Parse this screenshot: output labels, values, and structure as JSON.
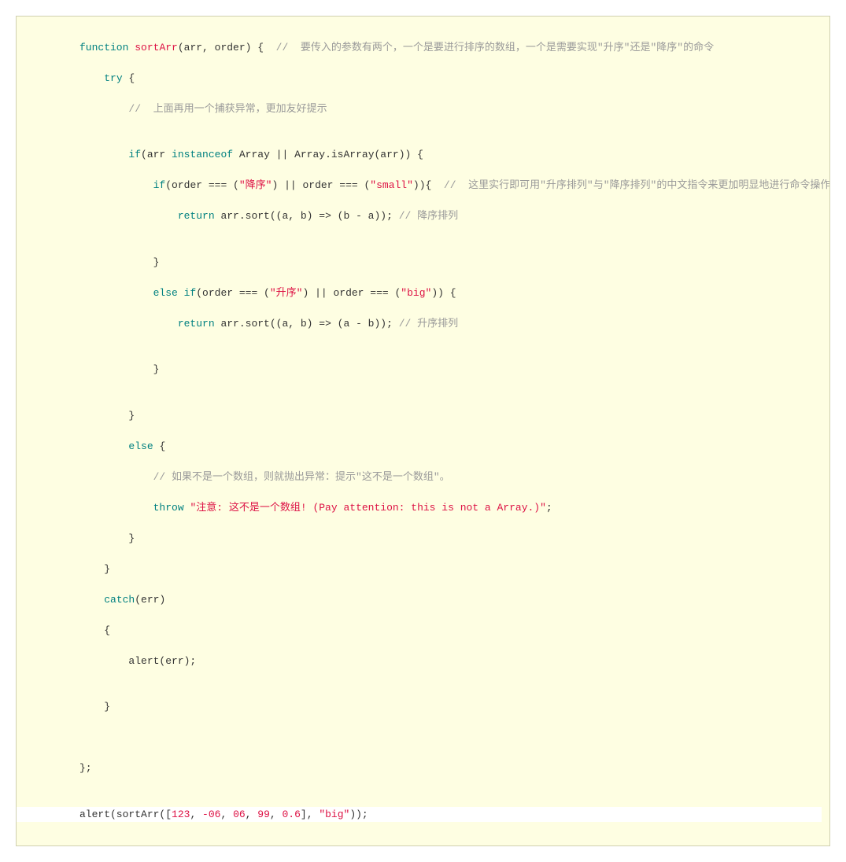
{
  "code": {
    "l1": {
      "kw1": "function",
      "fn": "sortArr",
      "p": "(arr, order) {",
      "cmt": "  //  要传入的参数有两个，一个是要进行排序的数组，一个是需要实现\"升序\"还是\"降序\"的命令"
    },
    "l2": {
      "kw": "try",
      "p": " {"
    },
    "l3": {
      "cmt": "//  上面再用一个捕获异常，更加友好提示"
    },
    "l4": {
      "t": ""
    },
    "l5": {
      "kw": "if",
      "p": "(arr ",
      "kw2": "instanceof",
      "p2": " Array || Array.isArray(arr)) {"
    },
    "l6": {
      "kw": "if",
      "p1": "(order === (",
      "s1": "\"降序\"",
      "p2": ") || order === (",
      "s2": "\"small\"",
      "p3": ")){",
      "cmt": "  //  这里实行即可用\"升序排列\"与\"降序排列\"的中文指令来更加明显地进行命令操作"
    },
    "l7": {
      "kw": "return",
      "p1": " arr.sort((a, b) => (b - a)); ",
      "cmt": "// 降序排列"
    },
    "l8": {
      "t": ""
    },
    "l9": {
      "p": "}"
    },
    "l10": {
      "kw": "else if",
      "p1": "(order === (",
      "s1": "\"升序\"",
      "p2": ") || order === (",
      "s2": "\"big\"",
      "p3": ")) {"
    },
    "l11": {
      "kw": "return",
      "p1": " arr.sort((a, b) => (a - b)); ",
      "cmt": "// 升序排列"
    },
    "l12": {
      "t": ""
    },
    "l13": {
      "p": "}"
    },
    "l14": {
      "t": ""
    },
    "l15": {
      "p": "}"
    },
    "l16": {
      "kw": "else",
      "p": " {"
    },
    "l17": {
      "cmt": "// 如果不是一个数组，则就抛出异常：提示\"这不是一个数组\"。"
    },
    "l18": {
      "kw": "throw",
      "p1": " ",
      "s": "\"注意: 这不是一个数组! (Pay attention: this is not a Array.)\"",
      "p2": ";"
    },
    "l19": {
      "p": "}"
    },
    "l20": {
      "p": "}"
    },
    "l21": {
      "kw": "catch",
      "p": "(err)"
    },
    "l22": {
      "p": "{"
    },
    "l23": {
      "p": "alert(err);"
    },
    "l24": {
      "t": ""
    },
    "l25": {
      "p": "}"
    },
    "l26": {
      "t": ""
    },
    "l27": {
      "t": ""
    },
    "l28": {
      "p": "};"
    },
    "l29": {
      "t": ""
    },
    "l30": {
      "p1": "alert(sortArr([",
      "n1": "123",
      "c1": ", ",
      "n2": "-06",
      "c2": ", ",
      "n3": "06",
      "c3": ", ",
      "n4": "99",
      "c4": ", ",
      "n5": "0.6",
      "p2": "], ",
      "s": "\"big\"",
      "p3": "));"
    }
  }
}
